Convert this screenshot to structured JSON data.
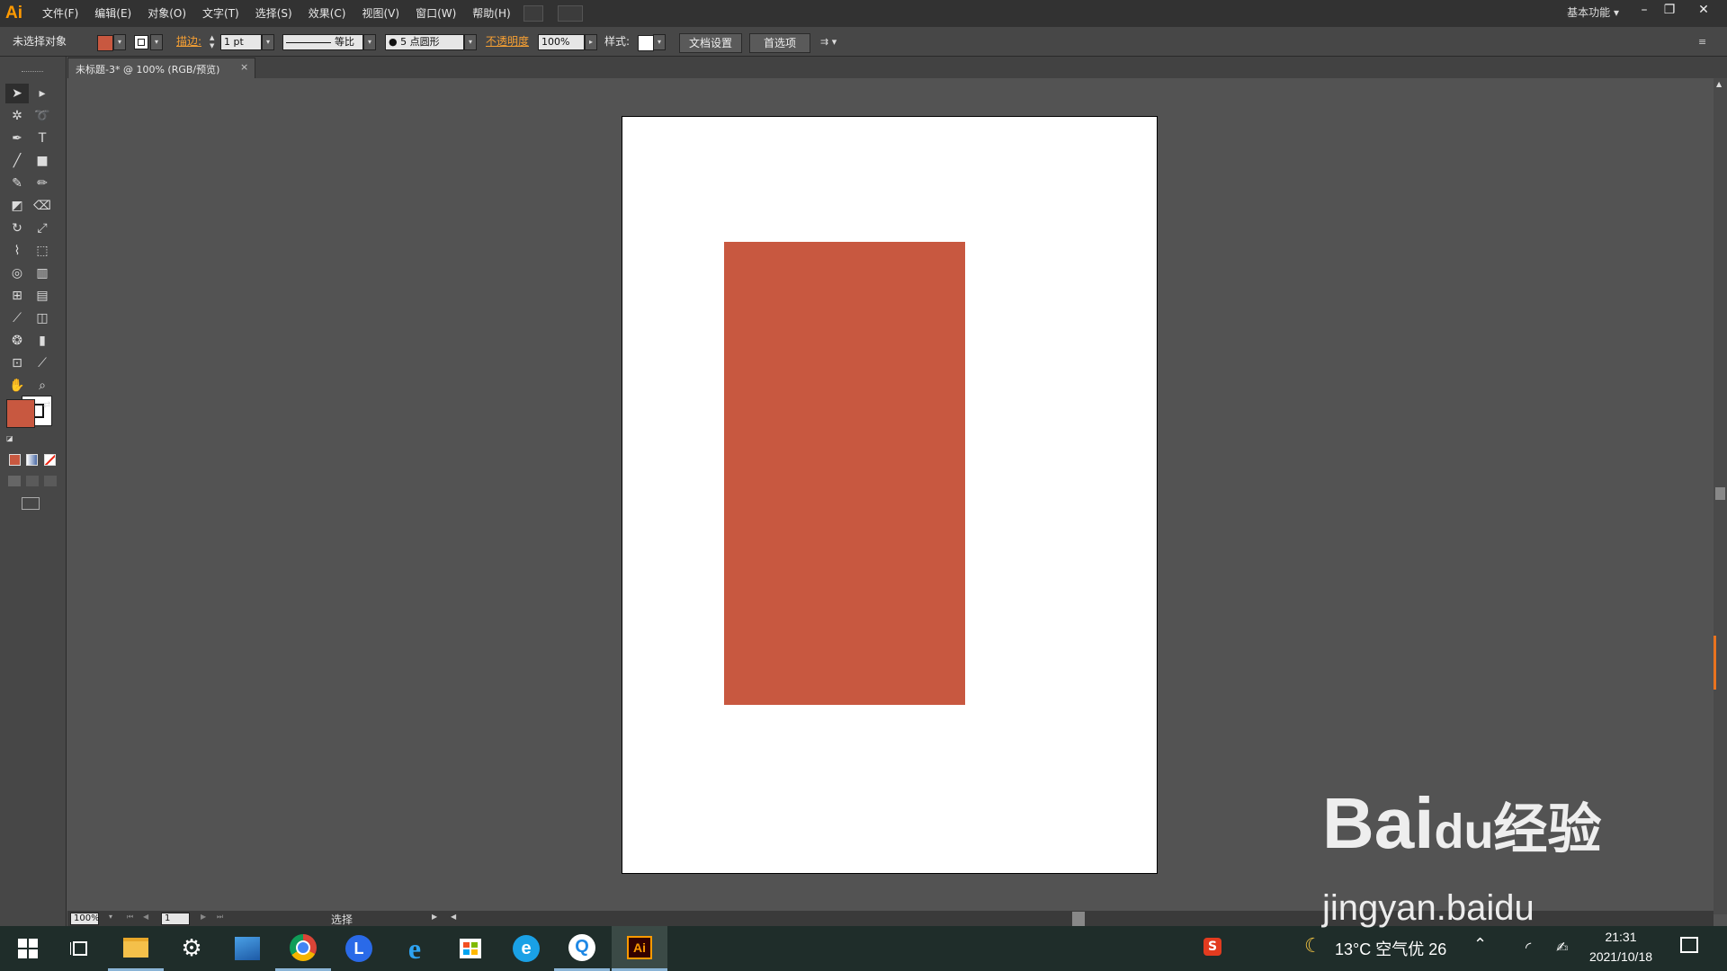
{
  "app": {
    "logo": "Ai",
    "workspace": "基本功能"
  },
  "menu": [
    {
      "label": "文件(F)"
    },
    {
      "label": "编辑(E)"
    },
    {
      "label": "对象(O)"
    },
    {
      "label": "文字(T)"
    },
    {
      "label": "选择(S)"
    },
    {
      "label": "效果(C)"
    },
    {
      "label": "视图(V)"
    },
    {
      "label": "窗口(W)"
    },
    {
      "label": "帮助(H)"
    }
  ],
  "control_bar": {
    "selection_label": "未选择对象",
    "stroke_label": "描边:",
    "stroke_weight": "1 pt",
    "stroke_profile": "等比",
    "brush": "5 点圆形",
    "opacity_label": "不透明度",
    "opacity_value": "100%",
    "style_label": "样式:",
    "doc_setup_button": "文档设置",
    "preferences_button": "首选项"
  },
  "document_tab": {
    "title": "未标题-3* @ 100% (RGB/预览)",
    "close": "×"
  },
  "tools": {
    "fill_color": "#c85840",
    "stroke_color": "#ffffff"
  },
  "canvas": {
    "artboard_color": "#ffffff",
    "rect_color": "#c85840"
  },
  "status_bar": {
    "zoom": "100%",
    "page": "1",
    "tool_status": "选择"
  },
  "taskbar": {
    "weather": "13°C 空气优 26",
    "time": "21:31",
    "date": "2021/10/18",
    "apps": [
      "start-icon",
      "task-view-icon",
      "file-explorer-icon",
      "settings-icon",
      "photos-icon",
      "chrome-icon",
      "l-app-icon",
      "ie-icon",
      "store-icon",
      "browser-e-icon",
      "q-browser-icon",
      "illustrator-icon"
    ],
    "illustrator_label": "Ai"
  },
  "watermark": {
    "brand": "Bai",
    "brand2": "du",
    "cn": "经验",
    "url": "jingyan.baidu"
  }
}
